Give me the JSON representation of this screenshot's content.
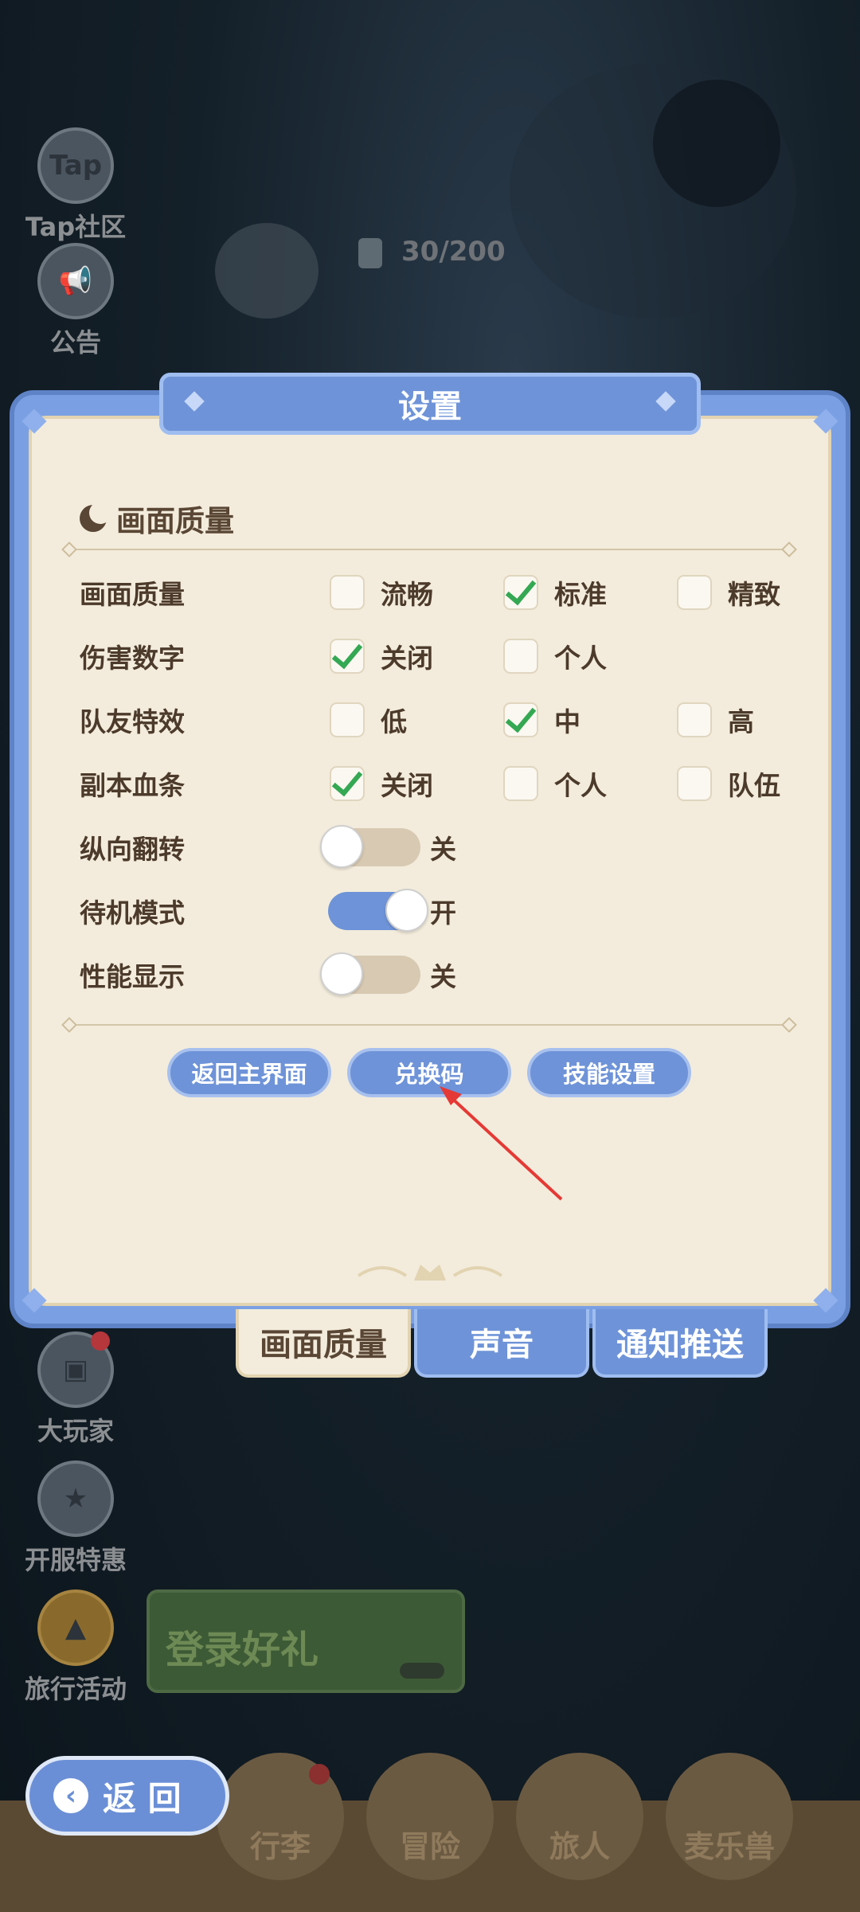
{
  "background": {
    "side_buttons": [
      {
        "label": "Tap社区",
        "icon": "Tap"
      },
      {
        "label": "公告",
        "icon": "speaker"
      },
      {
        "label": "大玩家",
        "icon": "screen"
      },
      {
        "label": "开服特惠",
        "icon": "gift"
      },
      {
        "label": "旅行活动",
        "icon": "tent"
      }
    ],
    "counter_text": "30/200",
    "gift_banner_text": "登录好礼",
    "bottom_nav": [
      "行李",
      "冒险",
      "旅人",
      "麦乐兽"
    ]
  },
  "back_button": {
    "label": "返 回"
  },
  "dialog": {
    "title": "设置",
    "section_title": "画面质量",
    "rows": [
      {
        "label": "画面质量",
        "options": [
          {
            "text": "流畅",
            "checked": false
          },
          {
            "text": "标准",
            "checked": true
          },
          {
            "text": "精致",
            "checked": false
          }
        ]
      },
      {
        "label": "伤害数字",
        "options": [
          {
            "text": "关闭",
            "checked": true
          },
          {
            "text": "个人",
            "checked": false
          }
        ]
      },
      {
        "label": "队友特效",
        "options": [
          {
            "text": "低",
            "checked": false
          },
          {
            "text": "中",
            "checked": true
          },
          {
            "text": "高",
            "checked": false
          }
        ]
      },
      {
        "label": "副本血条",
        "options": [
          {
            "text": "关闭",
            "checked": true
          },
          {
            "text": "个人",
            "checked": false
          },
          {
            "text": "队伍",
            "checked": false
          }
        ]
      }
    ],
    "toggles": [
      {
        "label": "纵向翻转",
        "state": "关",
        "on": false
      },
      {
        "label": "待机模式",
        "state": "开",
        "on": true
      },
      {
        "label": "性能显示",
        "state": "关",
        "on": false
      }
    ],
    "buttons": {
      "return_main": "返回主界面",
      "redeem_code": "兑换码",
      "skill_settings": "技能设置"
    }
  },
  "tabs": [
    {
      "label": "画面质量",
      "active": true
    },
    {
      "label": "声音",
      "active": false
    },
    {
      "label": "通知推送",
      "active": false
    }
  ],
  "colors": {
    "panel_blue": "#6e93d8",
    "panel_cream": "#f3ecdc",
    "check_green": "#34a853",
    "annotation_red": "#e53935"
  }
}
